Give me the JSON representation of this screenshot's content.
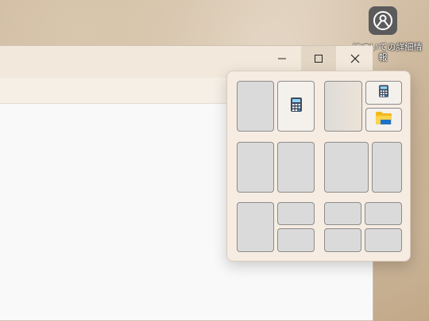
{
  "desktop": {
    "icon_label": "…についての詳細情報"
  },
  "window": {
    "controls": {
      "minimize": "—",
      "maximize": "☐",
      "close": "✕"
    }
  },
  "snap_layouts": {
    "apps": [
      "calculator-icon",
      "file-explorer-icon"
    ]
  }
}
